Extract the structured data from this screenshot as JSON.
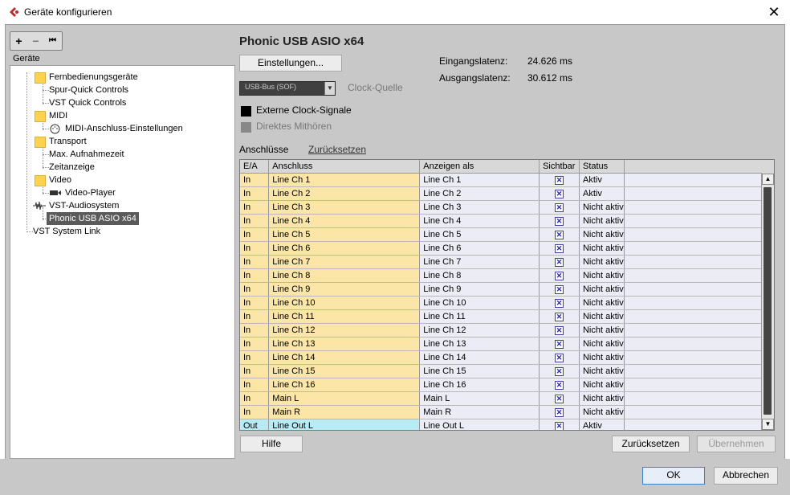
{
  "window": {
    "title": "Geräte konfigurieren"
  },
  "toolbar": {
    "add": "+",
    "remove": "−",
    "reset": "⏮"
  },
  "tree": {
    "header": "Geräte",
    "items": [
      {
        "label": "Fernbedienungsgeräte"
      },
      {
        "label": "Spur-Quick Controls"
      },
      {
        "label": "VST Quick Controls"
      },
      {
        "label": "MIDI"
      },
      {
        "label": "MIDI-Anschluss-Einstellungen"
      },
      {
        "label": "Transport"
      },
      {
        "label": "Max. Aufnahmezeit"
      },
      {
        "label": "Zeitanzeige"
      },
      {
        "label": "Video"
      },
      {
        "label": "Video-Player"
      },
      {
        "label": "VST-Audiosystem"
      },
      {
        "label": "Phonic USB ASIO x64"
      },
      {
        "label": "VST System Link"
      }
    ]
  },
  "panel": {
    "title": "Phonic USB ASIO x64",
    "settings_button": "Einstellungen...",
    "input_latency_label": "Eingangslatenz:",
    "input_latency_value": "24.626 ms",
    "output_latency_label": "Ausgangslatenz:",
    "output_latency_value": "30.612 ms",
    "clock_source_value": "USB-Bus (SOF)",
    "clock_source_label": "Clock-Quelle",
    "external_clock_label": "Externe Clock-Signale",
    "direct_monitor_label": "Direktes Mithören",
    "ports_tab": "Anschlüsse",
    "reset_link": "Zurücksetzen"
  },
  "table": {
    "columns": [
      "E/A",
      "Anschluss",
      "Anzeigen als",
      "Sichtbar",
      "Status"
    ],
    "rows": [
      {
        "io": "In",
        "port": "Line Ch 1",
        "show_as": "Line Ch 1",
        "visible": true,
        "status": "Aktiv"
      },
      {
        "io": "In",
        "port": "Line Ch 2",
        "show_as": "Line Ch 2",
        "visible": true,
        "status": "Aktiv"
      },
      {
        "io": "In",
        "port": "Line Ch 3",
        "show_as": "Line Ch 3",
        "visible": true,
        "status": "Nicht aktiv"
      },
      {
        "io": "In",
        "port": "Line Ch 4",
        "show_as": "Line Ch 4",
        "visible": true,
        "status": "Nicht aktiv"
      },
      {
        "io": "In",
        "port": "Line Ch 5",
        "show_as": "Line Ch 5",
        "visible": true,
        "status": "Nicht aktiv"
      },
      {
        "io": "In",
        "port": "Line Ch 6",
        "show_as": "Line Ch 6",
        "visible": true,
        "status": "Nicht aktiv"
      },
      {
        "io": "In",
        "port": "Line Ch 7",
        "show_as": "Line Ch 7",
        "visible": true,
        "status": "Nicht aktiv"
      },
      {
        "io": "In",
        "port": "Line Ch 8",
        "show_as": "Line Ch 8",
        "visible": true,
        "status": "Nicht aktiv"
      },
      {
        "io": "In",
        "port": "Line Ch 9",
        "show_as": "Line Ch 9",
        "visible": true,
        "status": "Nicht aktiv"
      },
      {
        "io": "In",
        "port": "Line Ch 10",
        "show_as": "Line Ch 10",
        "visible": true,
        "status": "Nicht aktiv"
      },
      {
        "io": "In",
        "port": "Line Ch 11",
        "show_as": "Line Ch 11",
        "visible": true,
        "status": "Nicht aktiv"
      },
      {
        "io": "In",
        "port": "Line Ch 12",
        "show_as": "Line Ch 12",
        "visible": true,
        "status": "Nicht aktiv"
      },
      {
        "io": "In",
        "port": "Line Ch 13",
        "show_as": "Line Ch 13",
        "visible": true,
        "status": "Nicht aktiv"
      },
      {
        "io": "In",
        "port": "Line Ch 14",
        "show_as": "Line Ch 14",
        "visible": true,
        "status": "Nicht aktiv"
      },
      {
        "io": "In",
        "port": "Line Ch 15",
        "show_as": "Line Ch 15",
        "visible": true,
        "status": "Nicht aktiv"
      },
      {
        "io": "In",
        "port": "Line Ch 16",
        "show_as": "Line Ch 16",
        "visible": true,
        "status": "Nicht aktiv"
      },
      {
        "io": "In",
        "port": "Main L",
        "show_as": "Main L",
        "visible": true,
        "status": "Nicht aktiv"
      },
      {
        "io": "In",
        "port": "Main R",
        "show_as": "Main R",
        "visible": true,
        "status": "Nicht aktiv"
      },
      {
        "io": "Out",
        "port": "Line Out L",
        "show_as": "Line Out L",
        "visible": true,
        "status": "Aktiv"
      }
    ]
  },
  "buttons": {
    "help": "Hilfe",
    "reset": "Zurücksetzen",
    "apply": "Übernehmen",
    "ok": "OK",
    "cancel": "Abbrechen"
  },
  "colors": {
    "input_row": "#fbe6a8",
    "output_row": "#b8ecf4",
    "panel_bg": "#c8c8c8"
  }
}
